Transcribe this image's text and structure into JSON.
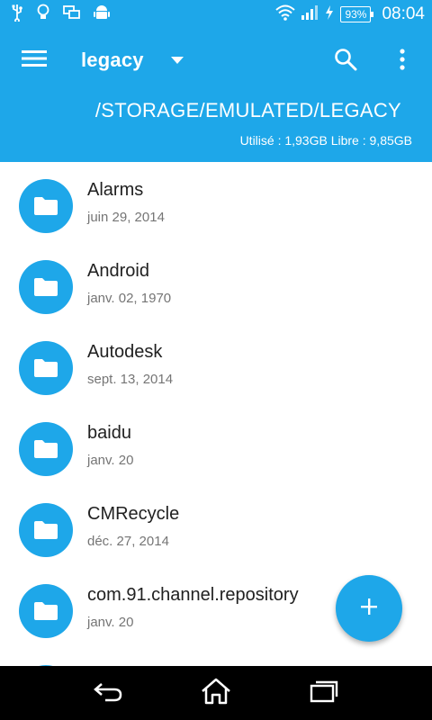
{
  "status_bar": {
    "battery": "93%",
    "time": "08:04",
    "left_icons": [
      "usb-icon",
      "bulb-icon",
      "screen-mirror-icon",
      "android-icon"
    ],
    "right_icons": [
      "wifi-icon",
      "signal-icon",
      "charging-icon"
    ]
  },
  "app_bar": {
    "title": "legacy",
    "path": "/STORAGE/EMULATED/LEGACY",
    "storage_info": "Utilisé : 1,93GB Libre : 9,85GB",
    "icons": [
      "menu-icon",
      "dropdown-icon",
      "search-icon",
      "more-vert-icon"
    ]
  },
  "files": [
    {
      "name": "Alarms",
      "date": "juin 29, 2014"
    },
    {
      "name": "Android",
      "date": "janv. 02, 1970"
    },
    {
      "name": "Autodesk",
      "date": "sept. 13, 2014"
    },
    {
      "name": "baidu",
      "date": "janv. 20"
    },
    {
      "name": "CMRecycle",
      "date": "déc. 27, 2014"
    },
    {
      "name": "com.91.channel.repository",
      "date": "janv. 20"
    }
  ],
  "fab": {
    "icon": "add-icon",
    "label": "+"
  },
  "nav_bar": {
    "icons": [
      "back-icon",
      "home-icon",
      "recents-icon"
    ]
  },
  "colors": {
    "accent": "#1ea7e9",
    "text_primary": "#212121",
    "text_secondary": "#757575",
    "nav_bg": "#000000"
  }
}
